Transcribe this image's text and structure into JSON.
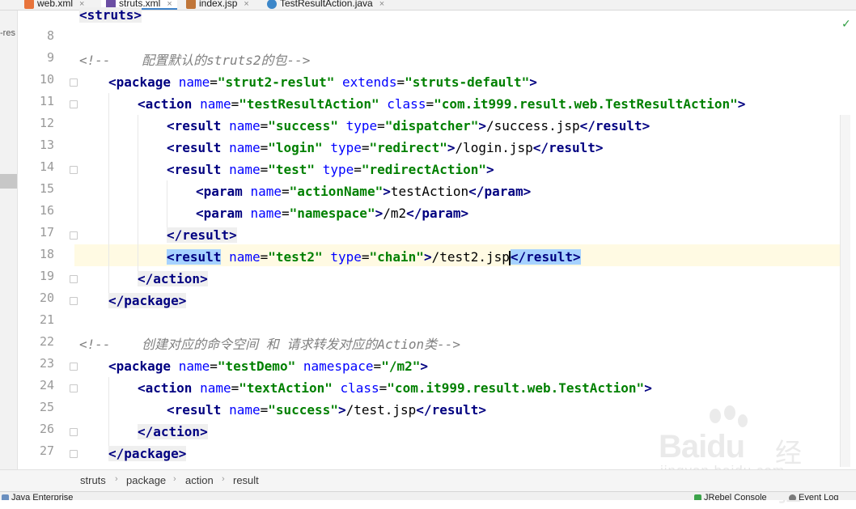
{
  "tabs": [
    {
      "label": "web.xml",
      "icon": "xml-file-icon",
      "icon_color": "#e8743b",
      "active": false
    },
    {
      "label": "struts.xml",
      "icon": "struts-file-icon",
      "icon_color": "#6b4ea3",
      "active": true
    },
    {
      "label": "index.jsp",
      "icon": "jsp-file-icon",
      "icon_color": "#c0763a",
      "active": false
    },
    {
      "label": "TestResultAction.java",
      "icon": "java-class-icon",
      "icon_color": "#3d87c9",
      "active": false
    }
  ],
  "tab_close_glyph": "×",
  "left_tool_label": "-res",
  "code": {
    "first_line_fragment": "<struts>",
    "lines": [
      {
        "n": "8"
      },
      {
        "n": "9",
        "comment": "<!--    配置默认的struts2的包-->"
      },
      {
        "n": "10",
        "open": "<package",
        "attrs": [
          [
            "name",
            "\"strut2-reslut\""
          ],
          [
            "extends",
            "\"struts-default\""
          ]
        ],
        "close": ">"
      },
      {
        "n": "11",
        "open": "<action",
        "attrs": [
          [
            "name",
            "\"testResultAction\""
          ],
          [
            "class",
            "\"com.it999.result.web.TestResultAction\""
          ]
        ],
        "close": ">"
      },
      {
        "n": "12",
        "open": "<result",
        "attrs": [
          [
            "name",
            "\"success\""
          ],
          [
            "type",
            "\"dispatcher\""
          ]
        ],
        "close": ">",
        "text": "/success.jsp",
        "end": "</result>"
      },
      {
        "n": "13",
        "open": "<result",
        "attrs": [
          [
            "name",
            "\"login\""
          ],
          [
            "type",
            "\"redirect\""
          ]
        ],
        "close": ">",
        "text": "/login.jsp",
        "end": "</result>"
      },
      {
        "n": "14",
        "open": "<result",
        "attrs": [
          [
            "name",
            "\"test\""
          ],
          [
            "type",
            "\"redirectAction\""
          ]
        ],
        "close": ">"
      },
      {
        "n": "15",
        "open": "<param",
        "attrs": [
          [
            "name",
            "\"actionName\""
          ]
        ],
        "close": ">",
        "text": "testAction",
        "end": "</param>"
      },
      {
        "n": "16",
        "open": "<param",
        "attrs": [
          [
            "name",
            "\"namespace\""
          ]
        ],
        "close": ">",
        "text": "/m2",
        "end": "</param>"
      },
      {
        "n": "17",
        "end": "</result>"
      },
      {
        "n": "18",
        "open": "<result",
        "attrs": [
          [
            "name",
            "\"test2\""
          ],
          [
            "type",
            "\"chain\""
          ]
        ],
        "close": ">",
        "text": "/test2.jsp",
        "end": "</result>",
        "current": true
      },
      {
        "n": "19",
        "end": "</action>"
      },
      {
        "n": "20",
        "end": "</package>"
      },
      {
        "n": "21"
      },
      {
        "n": "22",
        "comment": "<!--    创建对应的命令空间 和 请求转发对应的Action类-->"
      },
      {
        "n": "23",
        "open": "<package",
        "attrs": [
          [
            "name",
            "\"testDemo\""
          ],
          [
            "namespace",
            "\"/m2\""
          ]
        ],
        "close": ">"
      },
      {
        "n": "24",
        "open": "<action",
        "attrs": [
          [
            "name",
            "\"textAction\""
          ],
          [
            "class",
            "\"com.it999.result.web.TestAction\""
          ]
        ],
        "close": ">"
      },
      {
        "n": "25",
        "open": "<result",
        "attrs": [
          [
            "name",
            "\"success\""
          ]
        ],
        "close": ">",
        "text": "/test.jsp",
        "end": "</result>"
      },
      {
        "n": "26",
        "end": "</action>"
      },
      {
        "n": "27",
        "end": "</package>"
      }
    ]
  },
  "breadcrumbs": [
    "struts",
    "package",
    "action",
    "result"
  ],
  "breadcrumb_sep": "›",
  "status": {
    "left": "Java Enterprise",
    "right1": "JRebel Console",
    "right2": "Event Log"
  },
  "inspection_mark": "✓",
  "watermark": {
    "brand": "Bai",
    "brand2": "du",
    "cn": "经验",
    "url": "jingyan.baidu.com"
  },
  "colors": {
    "tag": "#000080",
    "attr_name": "#0000ff",
    "attr_value": "#008000",
    "comment": "#808080",
    "selection": "#a6d2ff",
    "current_line": "#fffae3"
  }
}
